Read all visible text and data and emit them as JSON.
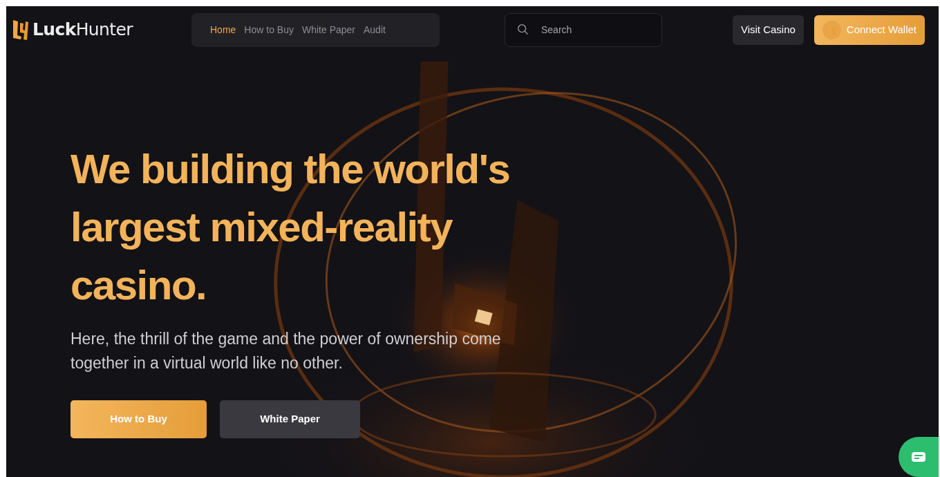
{
  "header": {
    "logo": "**Luck**Hunter",
    "nav": [
      {
        "label": "Home",
        "selected": true
      },
      {
        "label": "How to Buy",
        "selected": false
      },
      {
        "label": "White Paper",
        "selected": false
      },
      {
        "label": "Audit",
        "selected": false
      }
    ],
    "search": {
      "placeholder": "Search"
    },
    "buttons": [
      {
        "label": "Visit Casino",
        "kind": "secondary"
      },
      {
        "label": "Connect Wallet",
        "kind": "wallet"
      }
    ]
  },
  "hero": {
    "title": "We building the world's largest mixed-reality casino.",
    "subtitle": "Here, the thrill of the game and the power of ownership come together in a virtual world like no other.",
    "buttons": [
      {
        "label": "How to Buy",
        "kind": "primary"
      },
      {
        "label": "White Paper",
        "kind": "secondary"
      }
    ]
  }
}
